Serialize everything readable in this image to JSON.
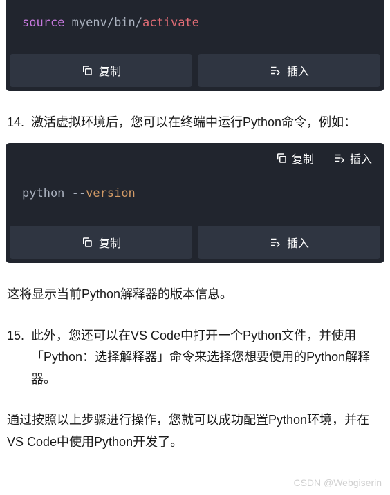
{
  "code_block_1": {
    "source_kw": "source",
    "rest": " myenv/bin/",
    "activate": "activate",
    "copy_label": "复制",
    "insert_label": "插入"
  },
  "list_14": {
    "number": "14.",
    "text": "激活虚拟环境后，您可以在终端中运行Python命令，例如："
  },
  "code_block_2": {
    "header_copy": "复制",
    "header_insert": "插入",
    "python": "python ",
    "dashes": "--",
    "version": "version",
    "copy_label": "复制",
    "insert_label": "插入"
  },
  "para_1": "这将显示当前Python解释器的版本信息。",
  "list_15": {
    "number": "15.",
    "text": "此外，您还可以在VS Code中打开一个Python文件，并使用「Python：选择解释器」命令来选择您想要使用的Python解释器。"
  },
  "para_2": "通过按照以上步骤进行操作，您就可以成功配置Python环境，并在VS Code中使用Python开发了。",
  "watermark": "CSDN @Webgiserin"
}
